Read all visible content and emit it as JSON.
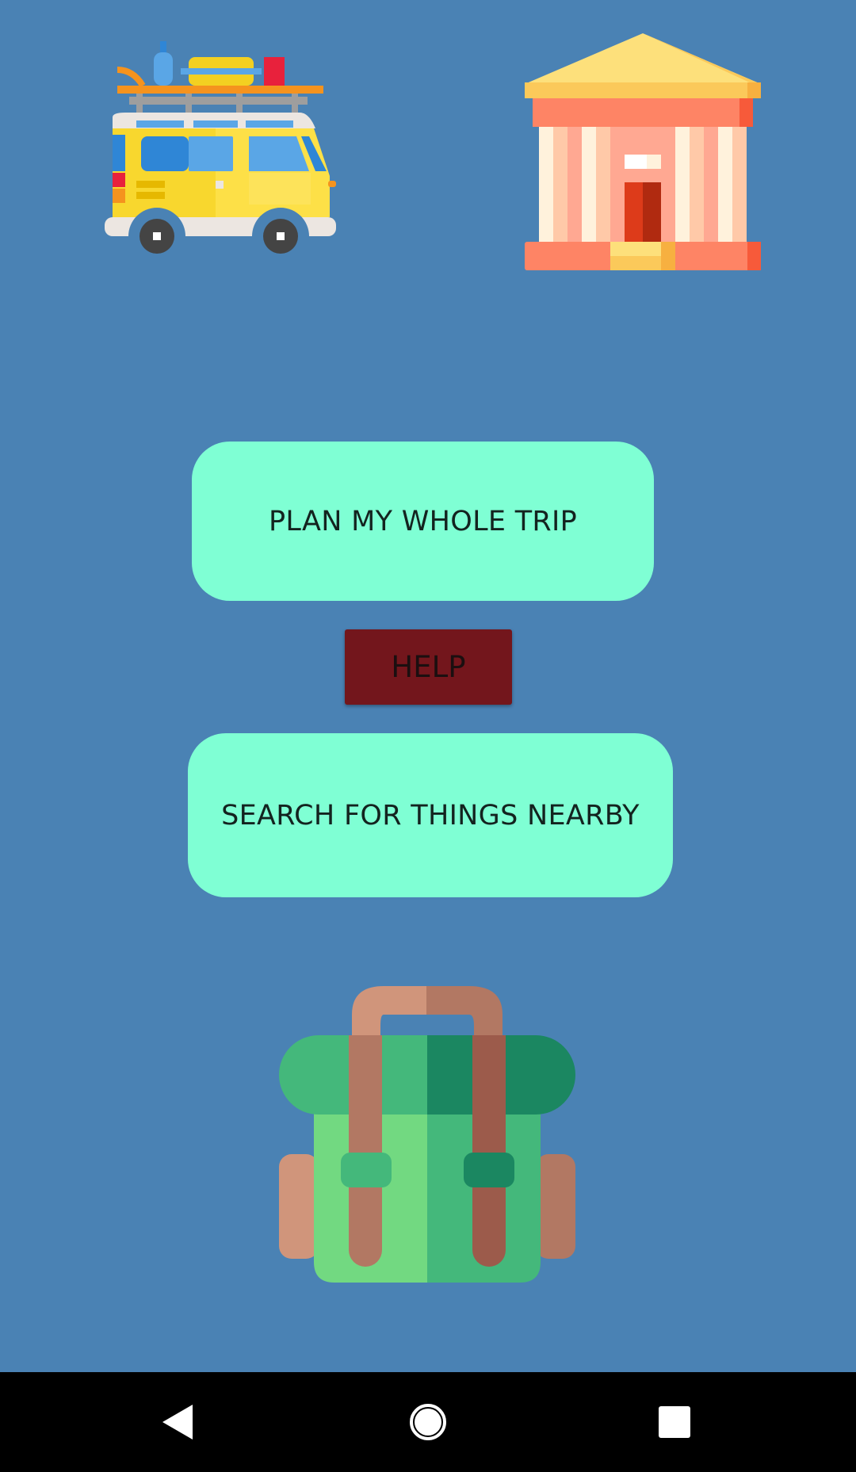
{
  "illustrations": {
    "van": "camper-van-icon",
    "museum": "museum-building-icon",
    "backpack": "backpack-icon"
  },
  "buttons": {
    "plan_trip": "PLAN MY WHOLE TRIP",
    "help": "HELP",
    "search_nearby": "SEARCH FOR THINGS NEARBY"
  },
  "nav": {
    "back": "back-icon",
    "home": "home-icon",
    "recents": "recents-icon"
  },
  "colors": {
    "background": "#4a82b4",
    "primary_button": "#7fffd4",
    "help_button": "#73161c",
    "navbar": "#000000"
  }
}
